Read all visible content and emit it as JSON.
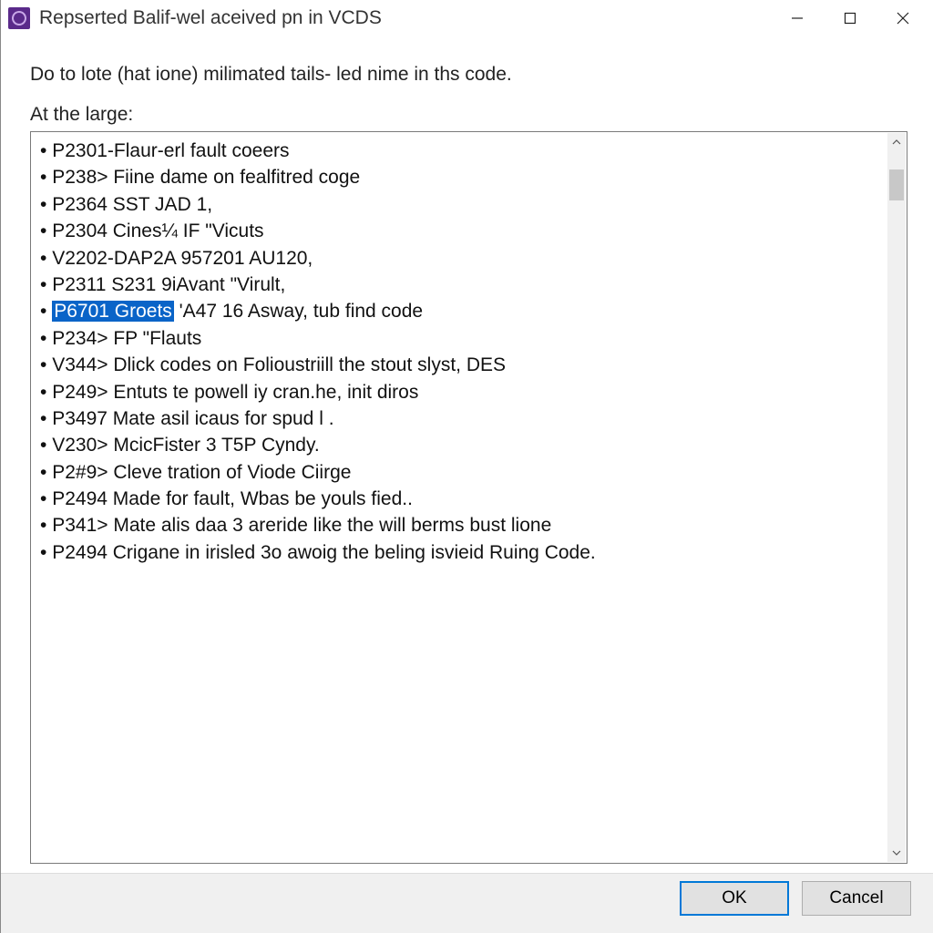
{
  "titlebar": {
    "title": "Repserted Balif-wel aceived pn in VCDS"
  },
  "content": {
    "intro": "Do to lote (hat ione) milimated tails- led nime in ths code.",
    "label": "At the large:"
  },
  "list": {
    "bullet": "•",
    "items": [
      "P2301-Flaur-erl fault coeers",
      "P238> Fiine dame on fealfitred coge",
      "P2364 SST JAD 1,",
      "P2304 Cines¼ IF \"Vicuts",
      "V2202-DAP2A 957201 AU120,",
      "P2311 S231 9iAvant \"Virult,",
      "",
      "P234> FP \"Flauts",
      "V344> Dlick codes on Folioustriill the stout slyst, DES",
      "P249> Entuts te powell iy cran.he, init diros",
      "P3497 Mate asil icaus for spud l .",
      "V230> McicFister 3 T5P Cyndy.",
      "P2#9> Cleve tration of Viode Ciirge",
      "P2494 Made for fault, Wbas be youls fied..",
      "P341> Mate alis daa 3 areride like the will berms bust lione",
      "P2494 Crigane in irisled 3o awoig the beling isvieid Ruing Code."
    ],
    "selected": {
      "highlighted": "P6701 Groets",
      "rest": " 'A47 16 Asway, tub find code"
    }
  },
  "buttons": {
    "ok": "OK",
    "cancel": "Cancel"
  }
}
